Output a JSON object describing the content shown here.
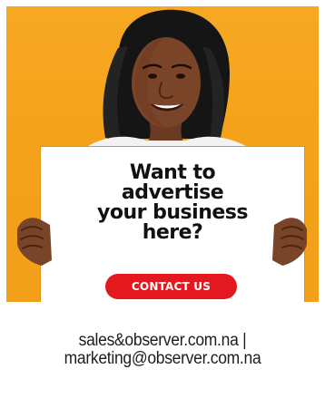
{
  "ad": {
    "headline_lines": [
      "Want to",
      "advertise",
      "your business",
      "here?"
    ],
    "button_label": "CONTACT US",
    "colors": {
      "background": "#f4a21a",
      "button": "#e4181f",
      "sign": "#ffffff",
      "text": "#111111"
    }
  },
  "contact": {
    "line1": "sales&observer.com.na |",
    "line2": "marketing@observer.com.na"
  }
}
